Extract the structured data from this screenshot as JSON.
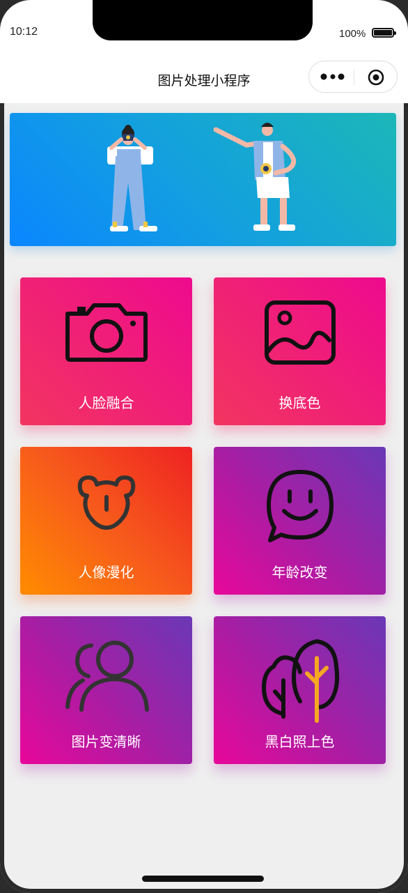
{
  "status_bar": {
    "time": "10:12",
    "battery_percent": "100%"
  },
  "nav": {
    "title": "图片处理小程序"
  },
  "banner": {
    "illustration": "photographers-illustration"
  },
  "features": [
    {
      "label": "人脸融合",
      "icon": "camera-icon",
      "style": "pink"
    },
    {
      "label": "换底色",
      "icon": "image-icon",
      "style": "pink"
    },
    {
      "label": "人像漫化",
      "icon": "bear-icon",
      "style": "orange"
    },
    {
      "label": "年龄改变",
      "icon": "smile-chat-icon",
      "style": "purple"
    },
    {
      "label": "图片变清晰",
      "icon": "users-icon",
      "style": "purple"
    },
    {
      "label": "黑白照上色",
      "icon": "trees-icon",
      "style": "purple"
    }
  ],
  "colors": {
    "banner_start": "#0a86ff",
    "banner_end": "#1cb7b8",
    "pink": "#ee0a8e",
    "orange": "#ff8c00",
    "purple": "#6a38b6",
    "magenta": "#e8079a",
    "tree_accent": "#f5a623"
  }
}
